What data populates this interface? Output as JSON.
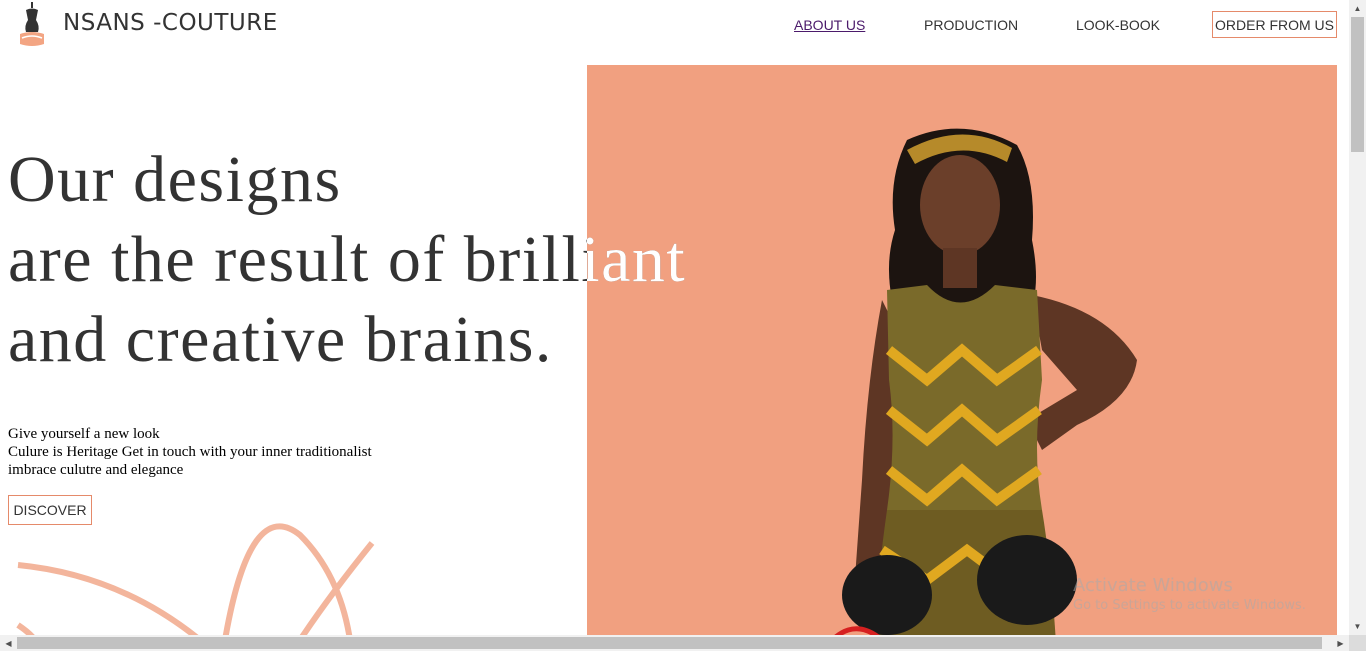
{
  "header": {
    "brand": "NSANS -COUTURE",
    "logo_icon": "dress-form-icon",
    "nav": {
      "about": "ABOUT US",
      "production": "PRODUCTION",
      "lookbook": "LOOK-BOOK",
      "order": "ORDER FROM US"
    }
  },
  "hero": {
    "headline": [
      "Our designs",
      "are the result of brilliant",
      "and creative brains."
    ],
    "tagline": [
      "Give yourself a new look",
      "Culure is Heritage Get in touch with your inner traditionalist",
      "imbrace culutre and elegance"
    ],
    "discover_label": "DISCOVER",
    "panel_color": "#f1a080",
    "accent_color": "#e58a6a"
  },
  "os_watermark": {
    "title": "Activate Windows",
    "subtitle": "Go to Settings to activate Windows."
  }
}
